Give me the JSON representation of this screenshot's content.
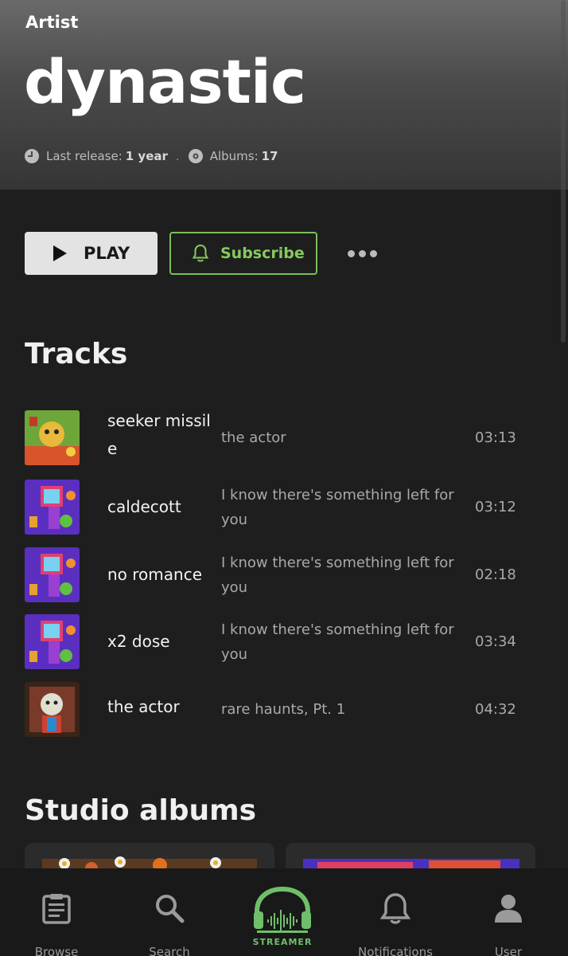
{
  "header": {
    "label": "Artist",
    "title": "dynastic",
    "last_release_label": "Last release:",
    "last_release_value": "1 year",
    "albums_label": "Albums:",
    "albums_value": "17"
  },
  "actions": {
    "play_label": "PLAY",
    "subscribe_label": "Subscribe"
  },
  "tracks_title": "Tracks",
  "tracks": [
    {
      "name": "seeker missile",
      "album": "the actor",
      "duration": "03:13"
    },
    {
      "name": "caldecott",
      "album": "I know there's something left for you",
      "duration": "03:12"
    },
    {
      "name": "no romance",
      "album": "I know there's something left for you",
      "duration": "02:18"
    },
    {
      "name": "x2 dose",
      "album": "I know there's something left for you",
      "duration": "03:34"
    },
    {
      "name": "the actor",
      "album": "rare haunts, Pt. 1",
      "duration": "04:32"
    }
  ],
  "albums_title": "Studio albums",
  "nav": [
    {
      "label": "Browse",
      "icon": "clipboard-icon"
    },
    {
      "label": "Search",
      "icon": "search-icon"
    },
    {
      "label": "STREAMER",
      "icon": "headphones-logo"
    },
    {
      "label": "Notifications",
      "icon": "bell-icon"
    },
    {
      "label": "User",
      "icon": "user-icon"
    }
  ],
  "colors": {
    "accent": "#7bbf56",
    "background": "#1e1e1e",
    "play_button": "#e3e3e3"
  }
}
